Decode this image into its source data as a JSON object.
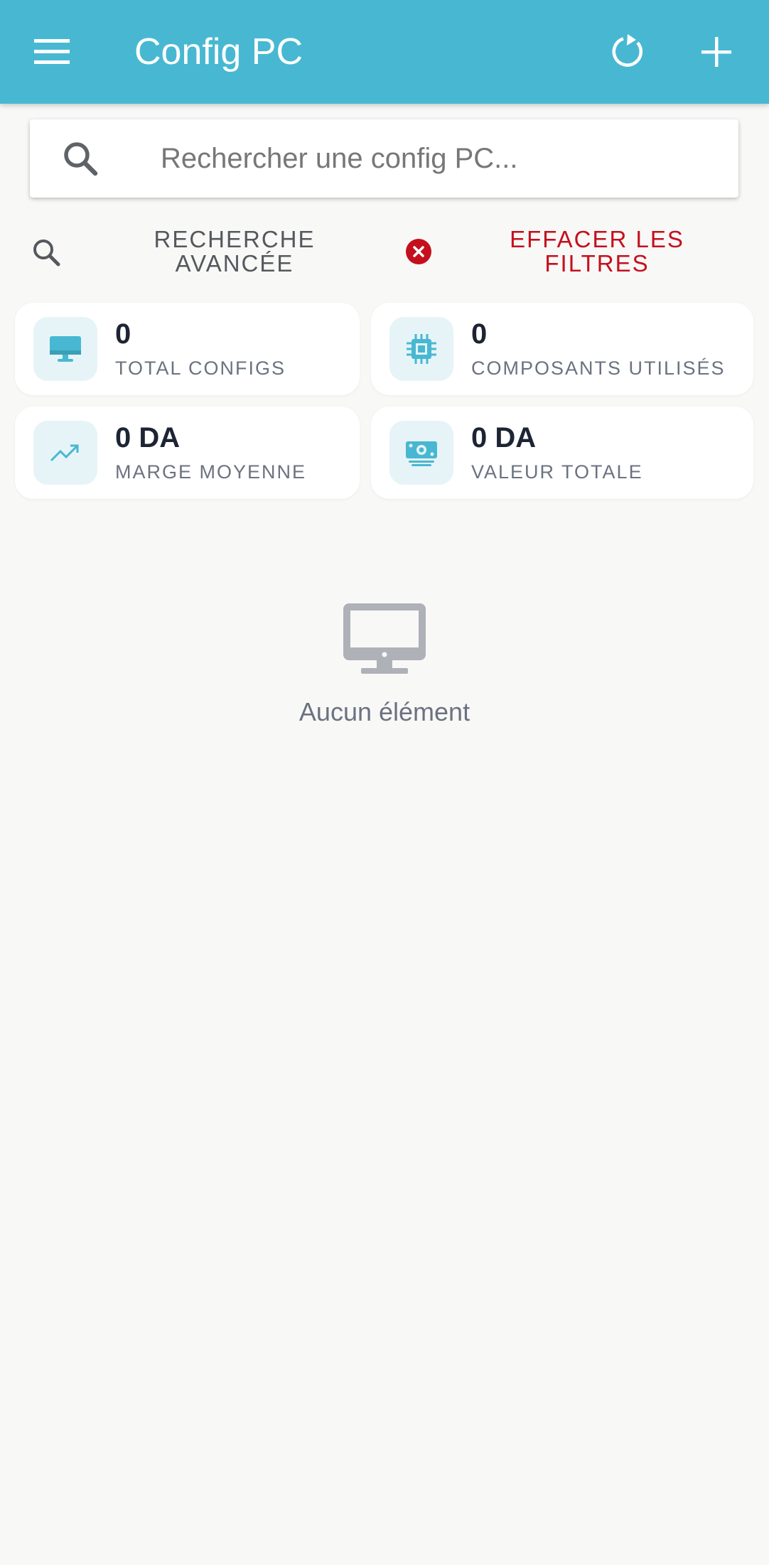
{
  "app_bar": {
    "title": "Config PC",
    "menu_icon": "menu-icon",
    "refresh_icon": "refresh-icon",
    "add_icon": "add-icon"
  },
  "search": {
    "placeholder": "Rechercher une config PC...",
    "value": "",
    "icon": "search-icon"
  },
  "filters": {
    "advanced_search_label": "RECHERCHE AVANCÉE",
    "clear_filters_label": "EFFACER LES FILTRES"
  },
  "stats": [
    {
      "value": "0",
      "label": "TOTAL CONFIGS",
      "icon": "desktop-icon"
    },
    {
      "value": "0",
      "label": "COMPOSANTS UTILISÉS",
      "icon": "chip-icon"
    },
    {
      "value": "0 DA",
      "label": "MARGE MOYENNE",
      "icon": "trending-up-icon"
    },
    {
      "value": "0 DA",
      "label": "VALEUR TOTALE",
      "icon": "money-icon"
    }
  ],
  "empty_state": {
    "text": "Aucun élément",
    "icon": "desktop-icon"
  },
  "colors": {
    "primary": "#48b8d2",
    "danger": "#c4101d",
    "background": "#f8f8f7",
    "icon_bg": "#e6f4f8",
    "text_dark": "#1d2433",
    "text_muted": "#6b7280"
  }
}
